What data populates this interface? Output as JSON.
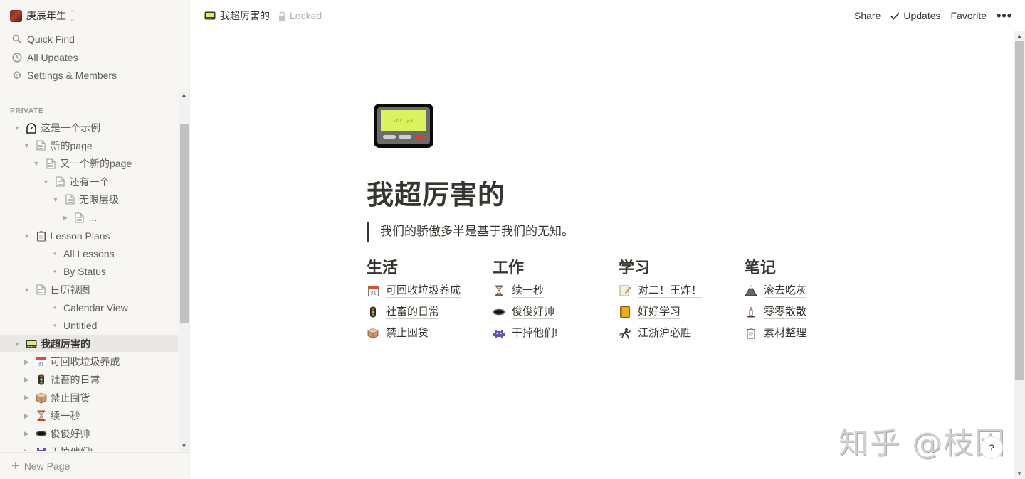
{
  "workspace": {
    "name": "庚辰年生"
  },
  "sidebar": {
    "nav": [
      {
        "label": "Quick Find",
        "icon": "search-icon"
      },
      {
        "label": "All Updates",
        "icon": "clock-icon"
      },
      {
        "label": "Settings & Members",
        "icon": "gear-icon"
      }
    ],
    "section_label": "PRIVATE",
    "tree": [
      {
        "label": "这是一个示例",
        "icon": "stopwatch-icon",
        "toggle": "expanded",
        "depth": 0
      },
      {
        "label": "新的page",
        "icon": "page-icon",
        "toggle": "expanded",
        "depth": 1
      },
      {
        "label": "又一个新的page",
        "icon": "page-icon",
        "toggle": "expanded",
        "depth": 2
      },
      {
        "label": "还有一个",
        "icon": "page-icon",
        "toggle": "expanded",
        "depth": 3
      },
      {
        "label": "无限层级",
        "icon": "page-icon",
        "toggle": "expanded",
        "depth": 4
      },
      {
        "label": "...",
        "icon": "page-icon",
        "toggle": "collapsed",
        "depth": 5
      },
      {
        "label": "Lesson Plans",
        "icon": "clipboard-icon",
        "toggle": "expanded",
        "depth": 1
      },
      {
        "label": "All Lessons",
        "icon": "bullet",
        "toggle": "none",
        "depth": 2
      },
      {
        "label": "By Status",
        "icon": "bullet",
        "toggle": "none",
        "depth": 2
      },
      {
        "label": "日历视图",
        "icon": "page-icon",
        "toggle": "expanded",
        "depth": 1
      },
      {
        "label": "Calendar View",
        "icon": "bullet",
        "toggle": "none",
        "depth": 2
      },
      {
        "label": "Untitled",
        "icon": "bullet",
        "toggle": "none",
        "depth": 2
      },
      {
        "label": "我超厉害的",
        "icon": "pager-icon",
        "toggle": "expanded",
        "depth": 0,
        "active": true
      },
      {
        "label": "可回收垃圾养成",
        "icon": "calendar-icon",
        "toggle": "collapsed",
        "depth": 1
      },
      {
        "label": "社畜的日常",
        "icon": "traffic-light-icon",
        "toggle": "collapsed",
        "depth": 1
      },
      {
        "label": "禁止囤货",
        "icon": "package-icon",
        "toggle": "collapsed",
        "depth": 1
      },
      {
        "label": "续一秒",
        "icon": "hourglass-icon",
        "toggle": "collapsed",
        "depth": 1
      },
      {
        "label": "俊俊好帅",
        "icon": "hole-icon",
        "toggle": "collapsed",
        "depth": 1
      },
      {
        "label": "干掉他们!",
        "icon": "space-invader-icon",
        "toggle": "collapsed",
        "depth": 1
      }
    ],
    "new_page_label": "New Page"
  },
  "topbar": {
    "breadcrumb": "我超厉害的",
    "locked_label": "Locked",
    "share_label": "Share",
    "updates_label": "Updates",
    "favorite_label": "Favorite",
    "more_label": "•••"
  },
  "page": {
    "title": "我超厉害的",
    "quote": "我们的骄傲多半是基于我们的无知。",
    "columns": [
      {
        "heading": "生活",
        "links": [
          {
            "label": "可回收垃圾养成",
            "icon": "calendar-icon"
          },
          {
            "label": "社畜的日常",
            "icon": "traffic-light-icon"
          },
          {
            "label": "禁止囤货",
            "icon": "package-icon"
          }
        ]
      },
      {
        "heading": "工作",
        "links": [
          {
            "label": "续一秒",
            "icon": "hourglass-icon"
          },
          {
            "label": "俊俊好帅",
            "icon": "hole-icon"
          },
          {
            "label": "干掉他们!",
            "icon": "space-invader-icon"
          }
        ]
      },
      {
        "heading": "学习",
        "links": [
          {
            "label": "对二！王炸！",
            "icon": "memo-icon"
          },
          {
            "label": "好好学习",
            "icon": "notebook-icon"
          },
          {
            "label": "江浙沪必胜",
            "icon": "running-person-icon"
          }
        ]
      },
      {
        "heading": "笔记",
        "links": [
          {
            "label": "滚去吃灰",
            "icon": "mountain-icon"
          },
          {
            "label": "零零散散",
            "icon": "candle-icon"
          },
          {
            "label": "素材整理",
            "icon": "clipboard-icon"
          }
        ]
      }
    ]
  },
  "watermark": "知乎 @枝因",
  "help_label": "?"
}
